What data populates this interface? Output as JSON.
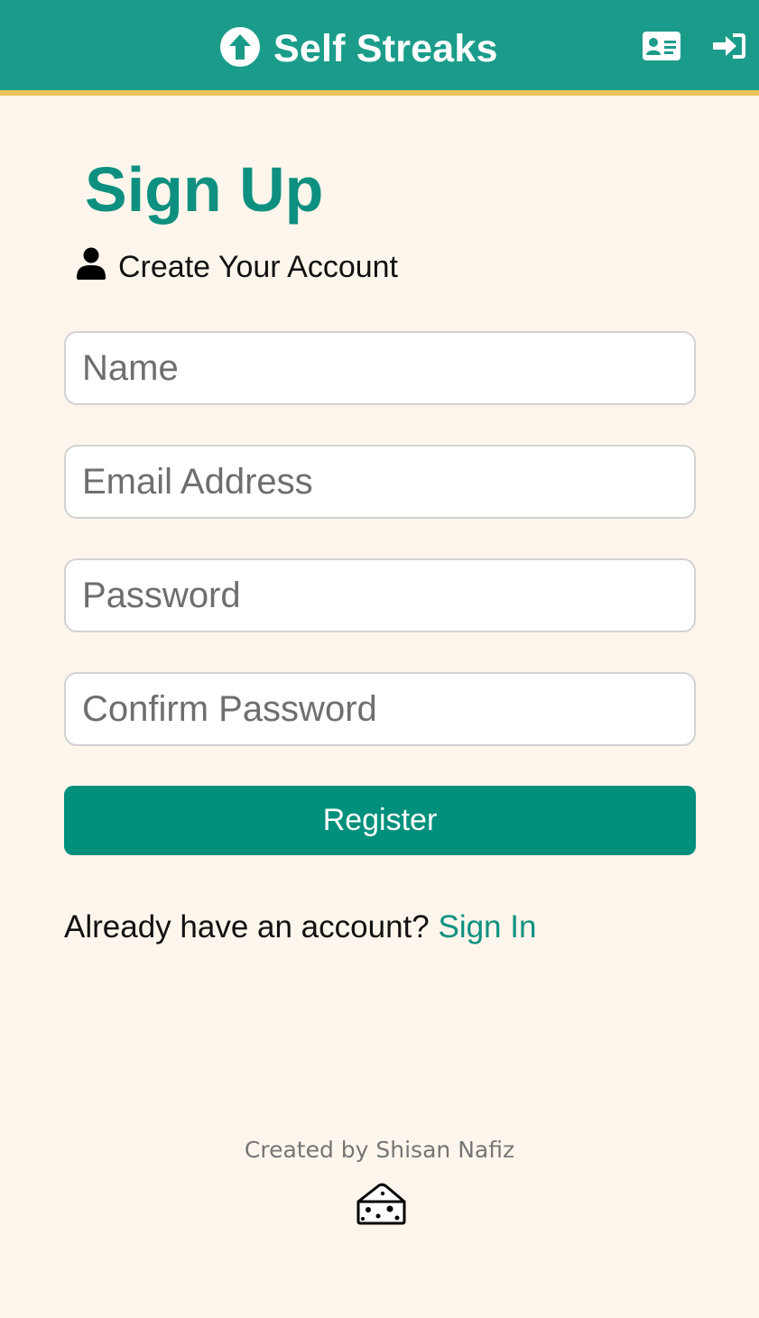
{
  "header": {
    "brand_title": "Self Streaks",
    "brand_icon": "circle-arrow-up-icon",
    "register_icon": "id-card-icon",
    "login_icon": "sign-in-icon",
    "colors": {
      "background": "#1b9c8a",
      "border": "#e9c35a"
    }
  },
  "main": {
    "title": "Sign Up",
    "subtitle": "Create Your Account",
    "subtitle_icon": "user-icon",
    "fields": {
      "name": {
        "placeholder": "Name",
        "value": ""
      },
      "email": {
        "placeholder": "Email Address",
        "value": ""
      },
      "password": {
        "placeholder": "Password",
        "value": ""
      },
      "confirm_password": {
        "placeholder": "Confirm Password",
        "value": ""
      }
    },
    "register_label": "Register",
    "already_text": "Already have an account?",
    "signin_label": "Sign In",
    "accent_color": "#0e9080"
  },
  "footer": {
    "credit": "Created by Shisan Nafiz",
    "icon": "cheese-icon"
  }
}
